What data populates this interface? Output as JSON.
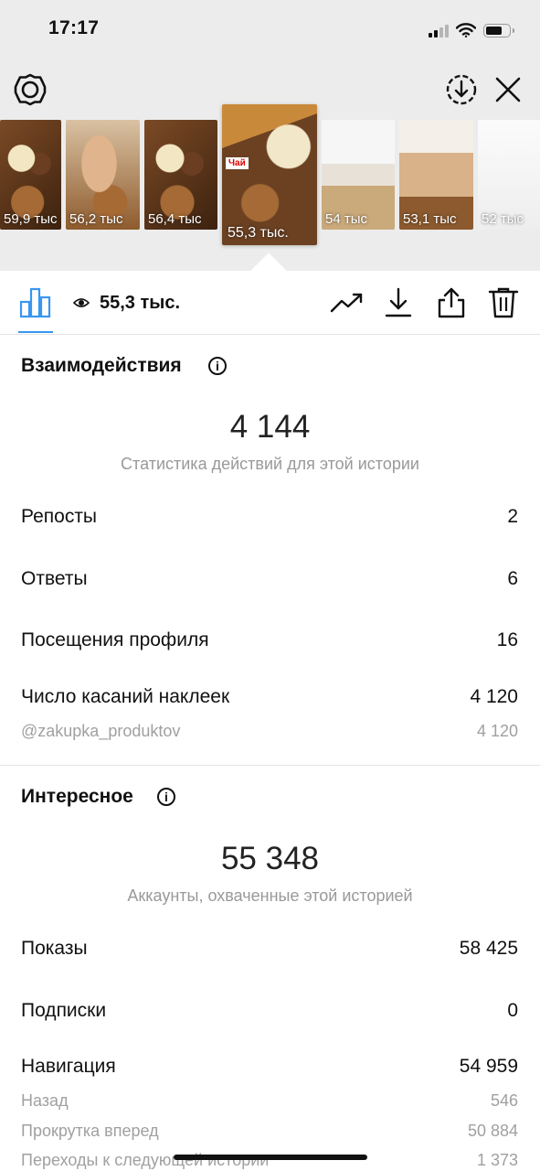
{
  "status_bar": {
    "time": "17:17"
  },
  "thumbnails": [
    {
      "views": "59,9 тыс"
    },
    {
      "views": "56,2 тыс"
    },
    {
      "views": "56,4 тыс"
    },
    {
      "views": "55,3 тыс.",
      "active": true,
      "tag": "Чай"
    },
    {
      "views": "54 тыс"
    },
    {
      "views": "53,1 тыс"
    },
    {
      "views": "52 тыс"
    }
  ],
  "toolbar": {
    "views_count": "55,3 тыс."
  },
  "interactions": {
    "title": "Взаимодействия",
    "total": "4 144",
    "caption": "Статистика действий для этой истории",
    "rows": [
      {
        "label": "Репосты",
        "value": "2"
      },
      {
        "label": "Ответы",
        "value": "6"
      },
      {
        "label": "Посещения профиля",
        "value": "16"
      },
      {
        "label": "Число касаний наклеек",
        "value": "4 120"
      }
    ],
    "sub_rows": [
      {
        "label": "@zakupka_produktov",
        "value": "4 120"
      }
    ]
  },
  "discovery": {
    "title": "Интересное",
    "total": "55 348",
    "caption": "Аккаунты, охваченные этой историей",
    "rows": [
      {
        "label": "Показы",
        "value": "58 425"
      },
      {
        "label": "Подписки",
        "value": "0"
      },
      {
        "label": "Навигация",
        "value": "54 959"
      }
    ],
    "sub_rows": [
      {
        "label": "Назад",
        "value": "546"
      },
      {
        "label": "Прокрутка вперед",
        "value": "50 884"
      },
      {
        "label": "Переходы к следующей истории",
        "value": "1 373"
      }
    ]
  }
}
